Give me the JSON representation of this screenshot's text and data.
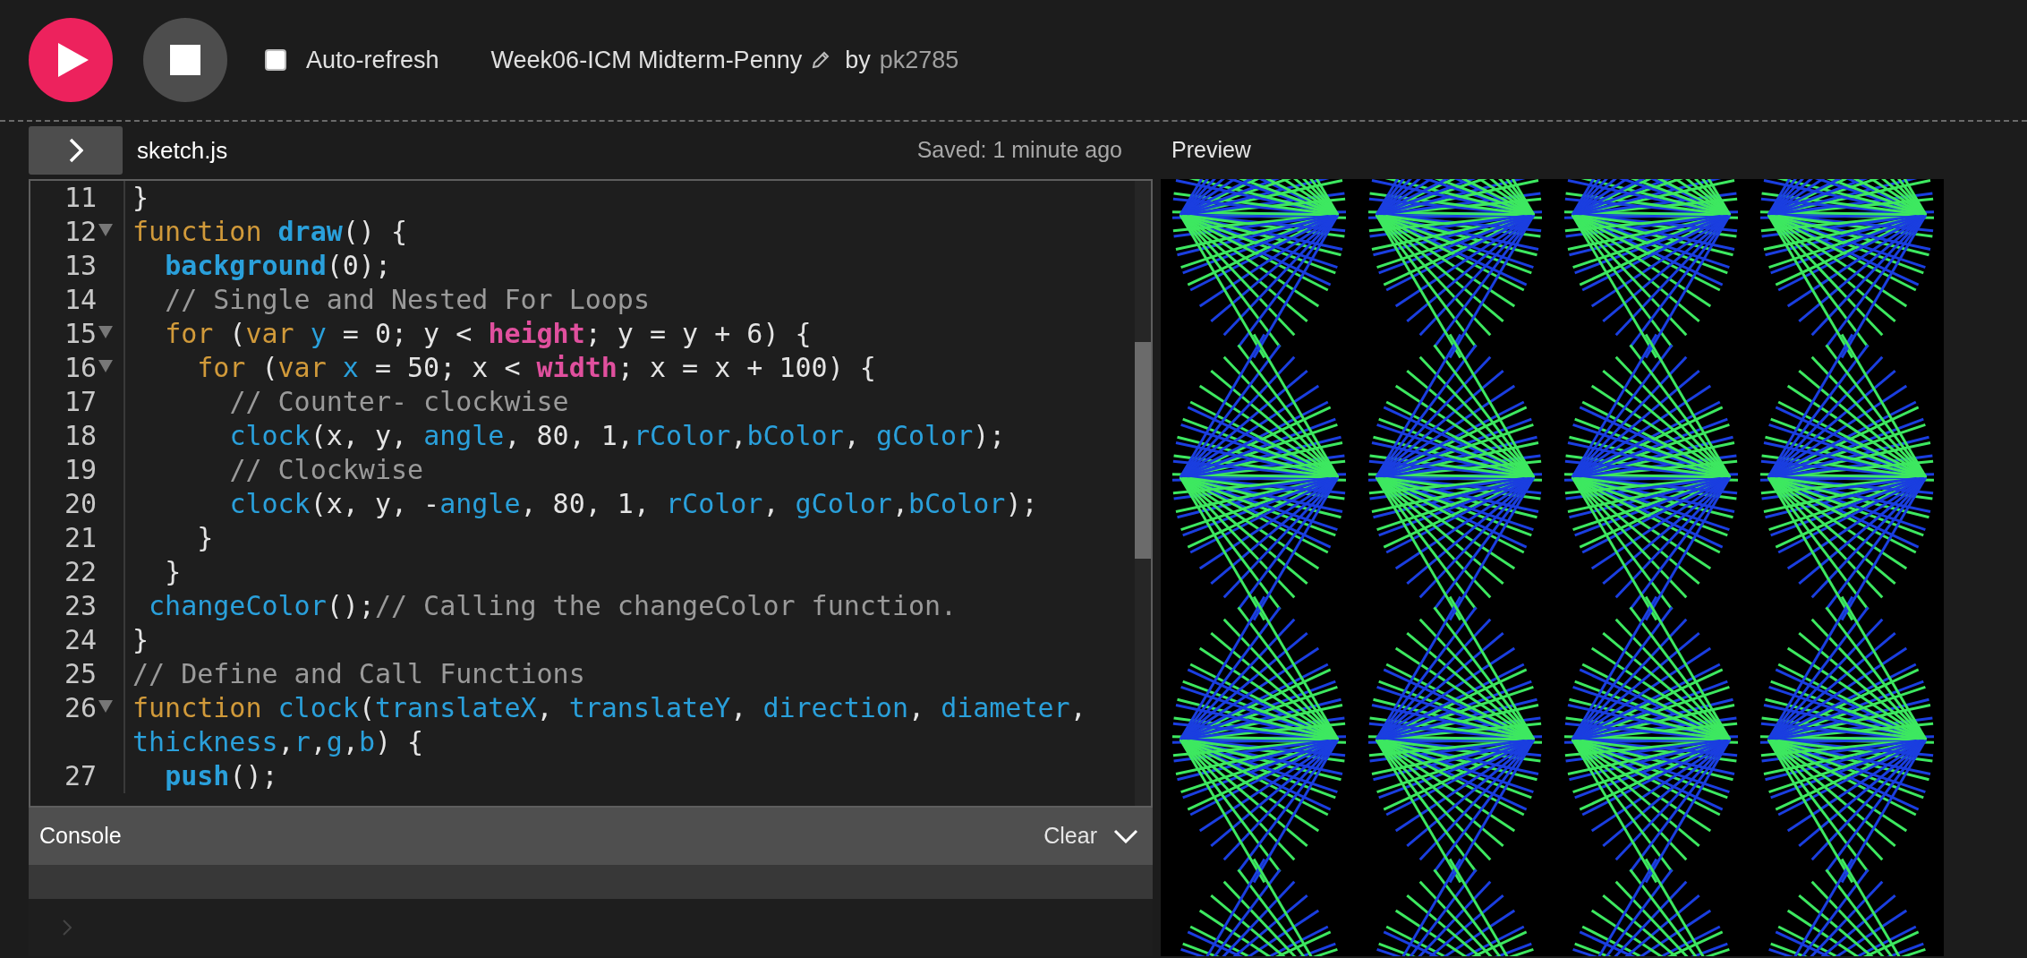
{
  "toolbar": {
    "auto_refresh": {
      "label": "Auto-refresh",
      "checked": false
    },
    "sketch_title": "Week06-ICM Midterm-Penny",
    "by": "by",
    "author": "pk2785"
  },
  "editor": {
    "filename": "sketch.js",
    "saved": "Saved: 1 minute ago",
    "lines": [
      {
        "number": "11",
        "fold": false,
        "tokens": [
          {
            "kind": "plain",
            "text": "}"
          }
        ]
      },
      {
        "number": "12",
        "fold": true,
        "tokens": [
          {
            "kind": "kw",
            "text": "function "
          },
          {
            "kind": "fnb",
            "text": "draw"
          },
          {
            "kind": "plain",
            "text": "() {"
          }
        ]
      },
      {
        "number": "13",
        "fold": false,
        "tokens": [
          {
            "kind": "fnb",
            "text": "  background"
          },
          {
            "kind": "plain",
            "text": "(0);"
          }
        ]
      },
      {
        "number": "14",
        "fold": false,
        "tokens": [
          {
            "kind": "comment",
            "text": "  // Single and Nested For Loops"
          }
        ]
      },
      {
        "number": "15",
        "fold": true,
        "tokens": [
          {
            "kind": "kw",
            "text": "  for"
          },
          {
            "kind": "plain",
            "text": " ("
          },
          {
            "kind": "kw",
            "text": "var "
          },
          {
            "kind": "var",
            "text": "y"
          },
          {
            "kind": "plain",
            "text": " = 0; y < "
          },
          {
            "kind": "def",
            "text": "height"
          },
          {
            "kind": "plain",
            "text": "; y = y + 6) {"
          }
        ]
      },
      {
        "number": "16",
        "fold": true,
        "tokens": [
          {
            "kind": "kw",
            "text": "    for"
          },
          {
            "kind": "plain",
            "text": " ("
          },
          {
            "kind": "kw",
            "text": "var "
          },
          {
            "kind": "var",
            "text": "x"
          },
          {
            "kind": "plain",
            "text": " = 50; x < "
          },
          {
            "kind": "def",
            "text": "width"
          },
          {
            "kind": "plain",
            "text": "; x = x + 100) {"
          }
        ]
      },
      {
        "number": "17",
        "fold": false,
        "tokens": [
          {
            "kind": "comment",
            "text": "      // Counter- clockwise"
          }
        ]
      },
      {
        "number": "18",
        "fold": false,
        "tokens": [
          {
            "kind": "var",
            "text": "      clock"
          },
          {
            "kind": "plain",
            "text": "(x, y, "
          },
          {
            "kind": "var",
            "text": "angle"
          },
          {
            "kind": "plain",
            "text": ", 80, 1,"
          },
          {
            "kind": "var",
            "text": "rColor"
          },
          {
            "kind": "plain",
            "text": ","
          },
          {
            "kind": "var",
            "text": "bColor"
          },
          {
            "kind": "plain",
            "text": ", "
          },
          {
            "kind": "var",
            "text": "gColor"
          },
          {
            "kind": "plain",
            "text": ");"
          }
        ]
      },
      {
        "number": "19",
        "fold": false,
        "tokens": [
          {
            "kind": "comment",
            "text": "      // Clockwise"
          }
        ]
      },
      {
        "number": "20",
        "fold": false,
        "tokens": [
          {
            "kind": "var",
            "text": "      clock"
          },
          {
            "kind": "plain",
            "text": "(x, y, -"
          },
          {
            "kind": "var",
            "text": "angle"
          },
          {
            "kind": "plain",
            "text": ", 80, 1, "
          },
          {
            "kind": "var",
            "text": "rColor"
          },
          {
            "kind": "plain",
            "text": ", "
          },
          {
            "kind": "var",
            "text": "gColor"
          },
          {
            "kind": "plain",
            "text": ","
          },
          {
            "kind": "var",
            "text": "bColor"
          },
          {
            "kind": "plain",
            "text": ");"
          }
        ]
      },
      {
        "number": "21",
        "fold": false,
        "tokens": [
          {
            "kind": "plain",
            "text": "    }"
          }
        ]
      },
      {
        "number": "22",
        "fold": false,
        "tokens": [
          {
            "kind": "plain",
            "text": "  }"
          }
        ]
      },
      {
        "number": "23",
        "fold": false,
        "tokens": [
          {
            "kind": "var",
            "text": " changeColor"
          },
          {
            "kind": "plain",
            "text": "();"
          },
          {
            "kind": "comment",
            "text": "// Calling the changeColor function."
          }
        ]
      },
      {
        "number": "24",
        "fold": false,
        "tokens": [
          {
            "kind": "plain",
            "text": "}"
          }
        ]
      },
      {
        "number": "25",
        "fold": false,
        "tokens": [
          {
            "kind": "comment",
            "text": "// Define and Call Functions"
          }
        ]
      },
      {
        "number": "26",
        "fold": true,
        "tokens": [
          {
            "kind": "kw",
            "text": "function "
          },
          {
            "kind": "var",
            "text": "clock"
          },
          {
            "kind": "plain",
            "text": "("
          },
          {
            "kind": "var",
            "text": "translateX"
          },
          {
            "kind": "plain",
            "text": ", "
          },
          {
            "kind": "var",
            "text": "translateY"
          },
          {
            "kind": "plain",
            "text": ", "
          },
          {
            "kind": "var",
            "text": "direction"
          },
          {
            "kind": "plain",
            "text": ", "
          },
          {
            "kind": "var",
            "text": "diameter"
          },
          {
            "kind": "plain",
            "text": ", "
          },
          {
            "kind": "var",
            "text": "thickness"
          },
          {
            "kind": "plain",
            "text": ","
          },
          {
            "kind": "var",
            "text": "r"
          },
          {
            "kind": "plain",
            "text": ","
          },
          {
            "kind": "var",
            "text": "g"
          },
          {
            "kind": "plain",
            "text": ","
          },
          {
            "kind": "var",
            "text": "b"
          },
          {
            "kind": "plain",
            "text": ") {"
          }
        ]
      },
      {
        "number": "27",
        "fold": false,
        "tokens": [
          {
            "kind": "fnb",
            "text": "  push"
          },
          {
            "kind": "plain",
            "text": "();"
          }
        ]
      }
    ]
  },
  "console": {
    "title": "Console",
    "clear": "Clear"
  },
  "preview": {
    "title": "Preview"
  }
}
